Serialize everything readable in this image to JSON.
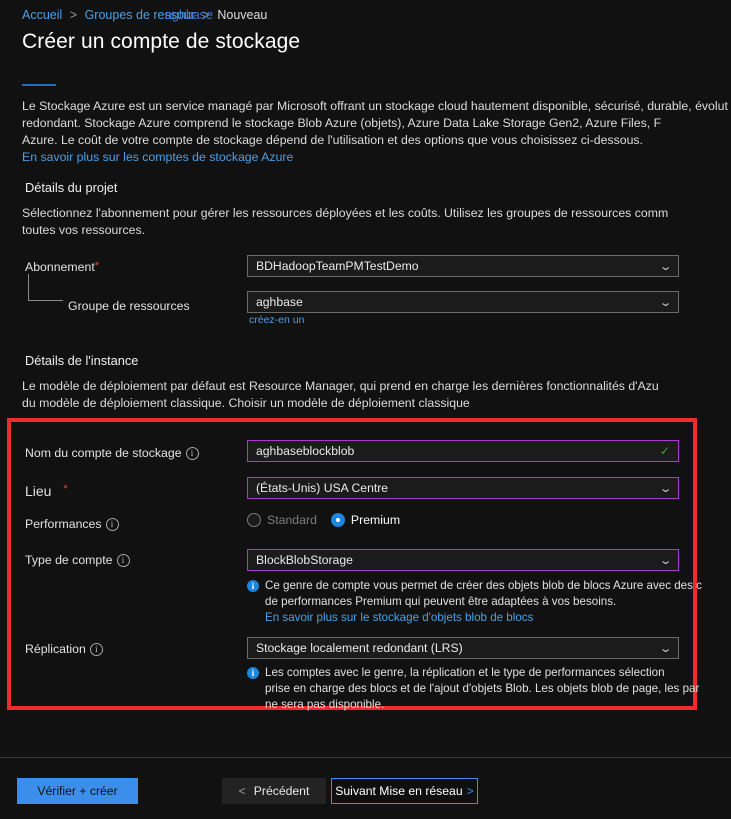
{
  "breadcrumb": {
    "items": [
      {
        "label": "Accueil",
        "type": "link"
      },
      {
        "label": "Groupes de ressour",
        "type": "link"
      },
      {
        "label": "Nouveau",
        "type": "plain"
      }
    ],
    "separator": ">",
    "overlay_link": "aghbase"
  },
  "header": {
    "title": "Créer un compte de stockage"
  },
  "intro": {
    "line1": "Le Stockage Azure est un service managé par Microsoft offrant un stockage cloud hautement disponible, sécurisé, durable, évolut",
    "line2": "redondant. Stockage Azure comprend le stockage Blob Azure (objets), Azure Data Lake Storage Gen2, Azure Files, F",
    "line3": "Azure. Le coût de votre compte de stockage dépend de l'utilisation et des options que vous choisissez ci-dessous.",
    "learn_more": "En savoir plus sur les comptes de stockage Azure"
  },
  "project_details": {
    "heading": "Détails du projet",
    "desc_line1": "Sélectionnez l'abonnement pour gérer les ressources déployées et les coûts. Utilisez les groupes de ressources comm",
    "desc_line2": "toutes vos ressources.",
    "subscription": {
      "label": "Abonnement",
      "required": "*",
      "value": "BDHadoopTeamPMTestDemo"
    },
    "resource_group": {
      "label": "Groupe de ressources",
      "value": "aghbase",
      "create_new": "créez-en un"
    }
  },
  "instance_details": {
    "heading": "Détails de l'instance",
    "desc_line1": "Le modèle de déploiement par défaut est Resource Manager, qui prend en charge les dernières fonctionnalités d'Azu",
    "desc_line2": "du modèle de déploiement classique. Choisir un modèle de déploiement classique",
    "storage_account_name": {
      "label": "Nom du compte de stockage",
      "value": "aghbaseblockblob",
      "valid": "✓"
    },
    "location": {
      "label": "Lieu",
      "required": "*",
      "value": "(États-Unis) USA Centre"
    },
    "performance": {
      "label": "Performances",
      "options": [
        {
          "label": "Standard",
          "selected": false,
          "disabled": true
        },
        {
          "label": "Premium",
          "selected": true,
          "disabled": false
        }
      ]
    },
    "account_kind": {
      "label": "Type de compte",
      "value": "BlockBlobStorage",
      "info_line1": "Ce genre de compte vous permet de créer des objets blob de blocs Azure avec des c",
      "info_line2": "de performances Premium qui peuvent être adaptées à vos besoins.",
      "info_link": "En savoir plus sur le stockage d'objets blob de blocs"
    },
    "replication": {
      "label": "Réplication",
      "value": "Stockage localement redondant (LRS)",
      "info_line1": "Les comptes avec le genre, la réplication et le type de performances sélection",
      "info_line2": "prise en charge des blocs et de l'ajout d'objets Blob. Les objets blob de page, les par",
      "info_line3": "ne sera pas disponible."
    }
  },
  "footer": {
    "review_create": "Vérifier + créer",
    "previous": "Précédent",
    "previous_chevron": "<",
    "next": "Suivant Mise en réseau",
    "next_chevron": ">"
  },
  "icons": {
    "chevron_down": "⌄",
    "info": "i"
  },
  "colors": {
    "accent_blue": "#3b8eea",
    "link_blue": "#4aa0e8",
    "highlight_red": "#ef2b2b",
    "field_purple": "#a83ad0",
    "valid_green": "#3ea33e"
  }
}
